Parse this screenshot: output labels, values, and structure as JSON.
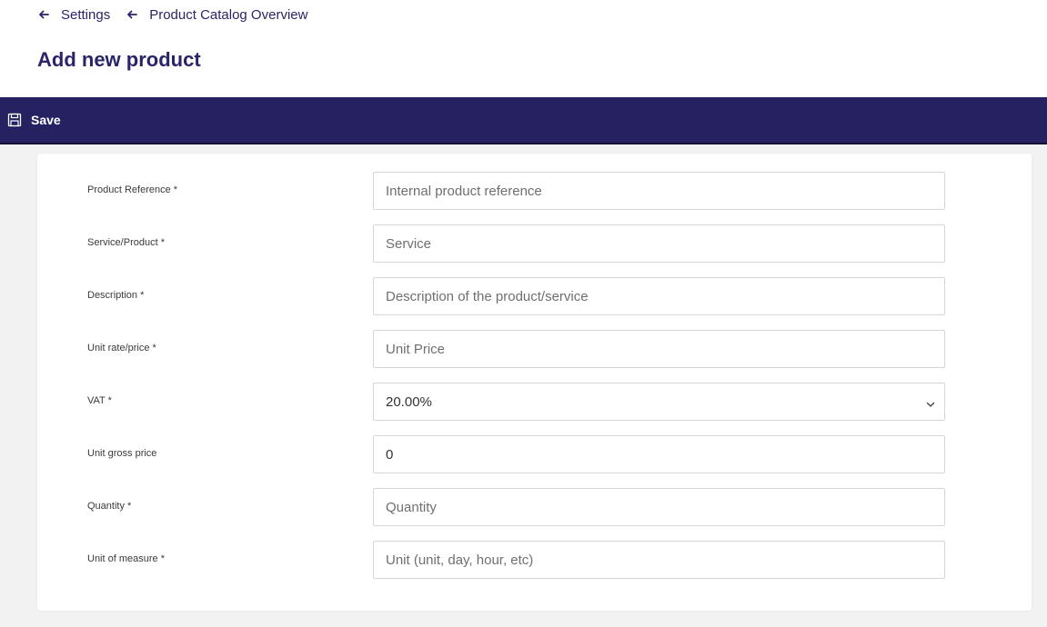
{
  "breadcrumb": {
    "items": [
      {
        "label": "Settings"
      },
      {
        "label": "Product Catalog Overview"
      }
    ]
  },
  "page": {
    "title": "Add new product"
  },
  "toolbar": {
    "save_label": "Save",
    "save_icon": "floppy-disk-icon"
  },
  "form": {
    "product_reference": {
      "label": "Product Reference *",
      "placeholder": "Internal product reference",
      "value": ""
    },
    "service_product": {
      "label": "Service/Product *",
      "placeholder": "Service",
      "value": ""
    },
    "description": {
      "label": "Description *",
      "placeholder": "Description of the product/service",
      "value": ""
    },
    "unit_price": {
      "label": "Unit rate/price *",
      "placeholder": "Unit Price",
      "value": ""
    },
    "vat": {
      "label": "VAT *",
      "selected": "20.00%"
    },
    "unit_gross_price": {
      "label": "Unit gross price",
      "value": "0"
    },
    "quantity": {
      "label": "Quantity *",
      "placeholder": "Quantity",
      "value": ""
    },
    "unit_of_measure": {
      "label": "Unit of measure *",
      "placeholder": "Unit (unit, day, hour, etc)",
      "value": ""
    }
  },
  "colors": {
    "brand_dark": "#262262",
    "title": "#2a2468",
    "background": "#f2f2f2",
    "input_border": "#d6d6d6"
  }
}
